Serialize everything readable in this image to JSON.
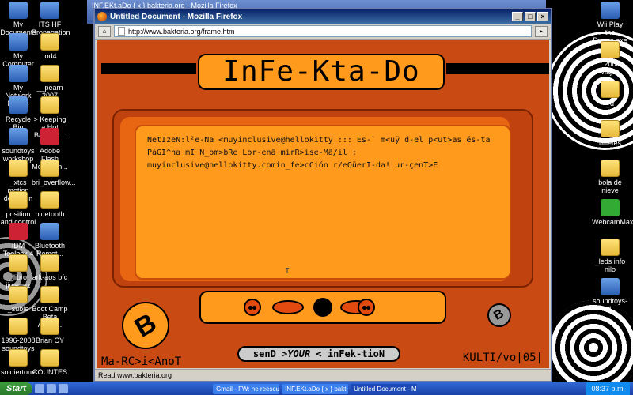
{
  "desktop_icons_left": [
    {
      "label": "My Documents",
      "type": "app"
    },
    {
      "label": "My Computer",
      "type": "app"
    },
    {
      "label": "My Network Places",
      "type": "app"
    },
    {
      "label": "Recycle Bin",
      "type": "app"
    },
    {
      "label": "soundtoys workshop",
      "type": "app"
    },
    {
      "label": "_xtcs motion detection",
      "type": "folder"
    },
    {
      "label": "position and control wi...",
      "type": "folder"
    },
    {
      "label": "IDM Toolbox 4",
      "type": "red"
    },
    {
      "label": "_libro jimenez",
      "type": "folder"
    },
    {
      "label": "_suble",
      "type": "folder"
    },
    {
      "label": "1996-2008 soundtoys",
      "type": "folder"
    },
    {
      "label": "soldiertone",
      "type": "folder"
    }
  ],
  "desktop_icons_col2": [
    {
      "label": "ITS HF Propagation",
      "type": "app"
    },
    {
      "label": "iod4",
      "type": "folder"
    },
    {
      "label": "__pearn 2007",
      "type": "folder"
    },
    {
      "label": "> Keeping a Hot Backup ...",
      "type": "folder"
    },
    {
      "label": "Adobe Flash Media En...",
      "type": "red"
    },
    {
      "label": "bri_overflow...",
      "type": "folder"
    },
    {
      "label": "bluetooth",
      "type": "folder"
    },
    {
      "label": "Bluetooth Remot...",
      "type": "app"
    },
    {
      "label": "ark-aos bfc",
      "type": "folder"
    },
    {
      "label": "Boot Camp Beta Apple...",
      "type": "folder"
    },
    {
      "label": "Brian CY",
      "type": "folder"
    },
    {
      "label": "COUNTES",
      "type": "folder"
    }
  ],
  "desktop_icons_right": [
    {
      "label": "Wii Play the Drums.exe",
      "type": "app"
    },
    {
      "label": "_2008 viajes",
      "type": "folder"
    },
    {
      "label": "_d",
      "type": "folder"
    },
    {
      "label": "billetes",
      "type": "folder"
    },
    {
      "label": "bola de nieve",
      "type": "folder"
    },
    {
      "label": "WebcamMax",
      "type": "green"
    },
    {
      "label": "_leds info nilo",
      "type": "folder"
    },
    {
      "label": "soundtoys-ed...",
      "type": "app"
    }
  ],
  "back_window": {
    "title": "INF.EKt.aDo { x } bakteria.org - Mozilla Firefox"
  },
  "window": {
    "title": "Untitled Document - Mozilla Firefox",
    "url": "http://www.bakteria.org/frame.htm",
    "status": "Read www.bakteria.org",
    "btn_min": "_",
    "btn_max": "□",
    "btn_close": "×"
  },
  "site": {
    "logo_text": "InFe-Kta-Do",
    "message": "NetIzeN:l²e-Na <muyinclusive@hellokitty :::  Es-` m<uÿ d-el p<ut>as és-ta PáGI^na mI N_om>bRe Lor-enã mirR>ise-Mã/il : muyinclusive@hellokitty.comin_fe>cCión r/eQüerI-da! ur-çenT>E",
    "cursor": "I",
    "signature_left": "Ma-RC>i<AnoT",
    "signature_right": "KULTI/vo|05|",
    "send_pre": "senD >",
    "send_em": "YOUR",
    "send_post": " < inFek-tioN",
    "b_logo": "B"
  },
  "taskbar": {
    "start_label": "Start",
    "tasks": [
      {
        "label": "Gmail - FW: he reescu...",
        "active": false
      },
      {
        "label": "INF.EKt.aDo { x } bakt...",
        "active": false
      },
      {
        "label": "Untitled Document - M...",
        "active": true
      }
    ],
    "clock": "08:37 p.m."
  }
}
